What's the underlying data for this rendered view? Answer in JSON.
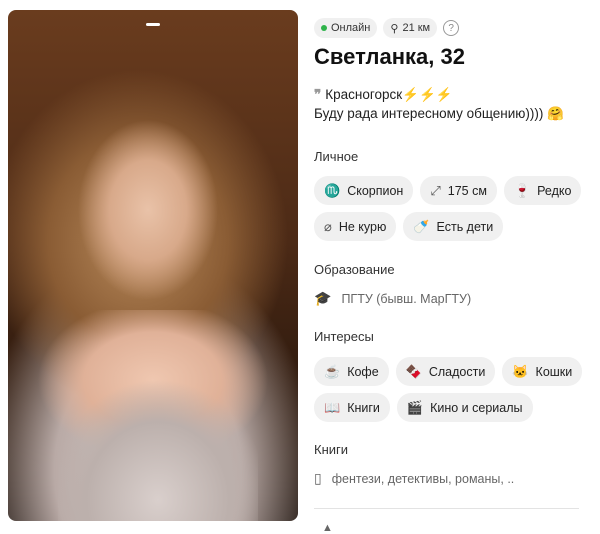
{
  "profile": {
    "online_label": "Онлайн",
    "distance": "21 км",
    "help": "?",
    "name_age": "Светланка, 32",
    "quote_line1": "Красногорск⚡⚡⚡",
    "quote_line2": "Буду рада интересному общению)))) 🤗"
  },
  "sections": {
    "personal": {
      "title": "Личное",
      "chips": [
        {
          "icon": "♏",
          "label": "Скорпион"
        },
        {
          "icon": "⤢",
          "label": "175 см"
        },
        {
          "icon": "🍷",
          "label": "Редко"
        },
        {
          "icon": "⌀",
          "label": "Не курю"
        },
        {
          "icon": "🍼",
          "label": "Есть дети"
        }
      ]
    },
    "education": {
      "title": "Образование",
      "icon": "🎓",
      "value": "ПГТУ (бывш. МарГТУ)"
    },
    "interests": {
      "title": "Интересы",
      "chips": [
        {
          "icon": "☕",
          "label": "Кофе"
        },
        {
          "icon": "🍫",
          "label": "Сладости"
        },
        {
          "icon": "🐱",
          "label": "Кошки"
        },
        {
          "icon": "📖",
          "label": "Книги"
        },
        {
          "icon": "🎬",
          "label": "Кино и сериалы"
        }
      ]
    },
    "books": {
      "title": "Книги",
      "icon": "▯",
      "value": "фентези, детективы, романы, .."
    }
  },
  "colors": {
    "online": "#2eb34a",
    "chip_bg": "#f0f0f0"
  }
}
